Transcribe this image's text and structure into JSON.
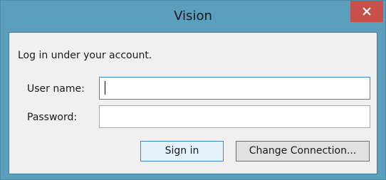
{
  "window": {
    "title": "Vision",
    "close_icon": "close-x-icon"
  },
  "form": {
    "intro": "Log in under your account.",
    "username_label": "User name:",
    "username_value": "",
    "password_label": "Password:",
    "password_value": ""
  },
  "buttons": {
    "sign_in": "Sign in",
    "change_connection": "Change Connection..."
  },
  "colors": {
    "frame": "#5b9fbd",
    "close_button": "#c7504a",
    "client_background": "#f0f0f0",
    "focus_accent": "#3c8ad4"
  }
}
